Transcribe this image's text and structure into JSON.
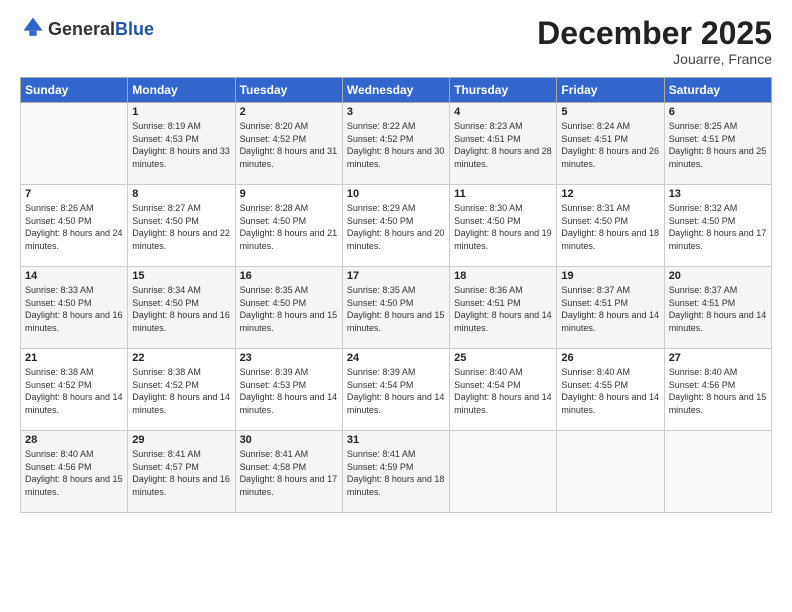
{
  "logo": {
    "general": "General",
    "blue": "Blue"
  },
  "header": {
    "month": "December 2025",
    "location": "Jouarre, France"
  },
  "weekdays": [
    "Sunday",
    "Monday",
    "Tuesday",
    "Wednesday",
    "Thursday",
    "Friday",
    "Saturday"
  ],
  "weeks": [
    [
      {
        "day": "",
        "sunrise": "",
        "sunset": "",
        "daylight": ""
      },
      {
        "day": "1",
        "sunrise": "Sunrise: 8:19 AM",
        "sunset": "Sunset: 4:53 PM",
        "daylight": "Daylight: 8 hours and 33 minutes."
      },
      {
        "day": "2",
        "sunrise": "Sunrise: 8:20 AM",
        "sunset": "Sunset: 4:52 PM",
        "daylight": "Daylight: 8 hours and 31 minutes."
      },
      {
        "day": "3",
        "sunrise": "Sunrise: 8:22 AM",
        "sunset": "Sunset: 4:52 PM",
        "daylight": "Daylight: 8 hours and 30 minutes."
      },
      {
        "day": "4",
        "sunrise": "Sunrise: 8:23 AM",
        "sunset": "Sunset: 4:51 PM",
        "daylight": "Daylight: 8 hours and 28 minutes."
      },
      {
        "day": "5",
        "sunrise": "Sunrise: 8:24 AM",
        "sunset": "Sunset: 4:51 PM",
        "daylight": "Daylight: 8 hours and 26 minutes."
      },
      {
        "day": "6",
        "sunrise": "Sunrise: 8:25 AM",
        "sunset": "Sunset: 4:51 PM",
        "daylight": "Daylight: 8 hours and 25 minutes."
      }
    ],
    [
      {
        "day": "7",
        "sunrise": "Sunrise: 8:26 AM",
        "sunset": "Sunset: 4:50 PM",
        "daylight": "Daylight: 8 hours and 24 minutes."
      },
      {
        "day": "8",
        "sunrise": "Sunrise: 8:27 AM",
        "sunset": "Sunset: 4:50 PM",
        "daylight": "Daylight: 8 hours and 22 minutes."
      },
      {
        "day": "9",
        "sunrise": "Sunrise: 8:28 AM",
        "sunset": "Sunset: 4:50 PM",
        "daylight": "Daylight: 8 hours and 21 minutes."
      },
      {
        "day": "10",
        "sunrise": "Sunrise: 8:29 AM",
        "sunset": "Sunset: 4:50 PM",
        "daylight": "Daylight: 8 hours and 20 minutes."
      },
      {
        "day": "11",
        "sunrise": "Sunrise: 8:30 AM",
        "sunset": "Sunset: 4:50 PM",
        "daylight": "Daylight: 8 hours and 19 minutes."
      },
      {
        "day": "12",
        "sunrise": "Sunrise: 8:31 AM",
        "sunset": "Sunset: 4:50 PM",
        "daylight": "Daylight: 8 hours and 18 minutes."
      },
      {
        "day": "13",
        "sunrise": "Sunrise: 8:32 AM",
        "sunset": "Sunset: 4:50 PM",
        "daylight": "Daylight: 8 hours and 17 minutes."
      }
    ],
    [
      {
        "day": "14",
        "sunrise": "Sunrise: 8:33 AM",
        "sunset": "Sunset: 4:50 PM",
        "daylight": "Daylight: 8 hours and 16 minutes."
      },
      {
        "day": "15",
        "sunrise": "Sunrise: 8:34 AM",
        "sunset": "Sunset: 4:50 PM",
        "daylight": "Daylight: 8 hours and 16 minutes."
      },
      {
        "day": "16",
        "sunrise": "Sunrise: 8:35 AM",
        "sunset": "Sunset: 4:50 PM",
        "daylight": "Daylight: 8 hours and 15 minutes."
      },
      {
        "day": "17",
        "sunrise": "Sunrise: 8:35 AM",
        "sunset": "Sunset: 4:50 PM",
        "daylight": "Daylight: 8 hours and 15 minutes."
      },
      {
        "day": "18",
        "sunrise": "Sunrise: 8:36 AM",
        "sunset": "Sunset: 4:51 PM",
        "daylight": "Daylight: 8 hours and 14 minutes."
      },
      {
        "day": "19",
        "sunrise": "Sunrise: 8:37 AM",
        "sunset": "Sunset: 4:51 PM",
        "daylight": "Daylight: 8 hours and 14 minutes."
      },
      {
        "day": "20",
        "sunrise": "Sunrise: 8:37 AM",
        "sunset": "Sunset: 4:51 PM",
        "daylight": "Daylight: 8 hours and 14 minutes."
      }
    ],
    [
      {
        "day": "21",
        "sunrise": "Sunrise: 8:38 AM",
        "sunset": "Sunset: 4:52 PM",
        "daylight": "Daylight: 8 hours and 14 minutes."
      },
      {
        "day": "22",
        "sunrise": "Sunrise: 8:38 AM",
        "sunset": "Sunset: 4:52 PM",
        "daylight": "Daylight: 8 hours and 14 minutes."
      },
      {
        "day": "23",
        "sunrise": "Sunrise: 8:39 AM",
        "sunset": "Sunset: 4:53 PM",
        "daylight": "Daylight: 8 hours and 14 minutes."
      },
      {
        "day": "24",
        "sunrise": "Sunrise: 8:39 AM",
        "sunset": "Sunset: 4:54 PM",
        "daylight": "Daylight: 8 hours and 14 minutes."
      },
      {
        "day": "25",
        "sunrise": "Sunrise: 8:40 AM",
        "sunset": "Sunset: 4:54 PM",
        "daylight": "Daylight: 8 hours and 14 minutes."
      },
      {
        "day": "26",
        "sunrise": "Sunrise: 8:40 AM",
        "sunset": "Sunset: 4:55 PM",
        "daylight": "Daylight: 8 hours and 14 minutes."
      },
      {
        "day": "27",
        "sunrise": "Sunrise: 8:40 AM",
        "sunset": "Sunset: 4:56 PM",
        "daylight": "Daylight: 8 hours and 15 minutes."
      }
    ],
    [
      {
        "day": "28",
        "sunrise": "Sunrise: 8:40 AM",
        "sunset": "Sunset: 4:56 PM",
        "daylight": "Daylight: 8 hours and 15 minutes."
      },
      {
        "day": "29",
        "sunrise": "Sunrise: 8:41 AM",
        "sunset": "Sunset: 4:57 PM",
        "daylight": "Daylight: 8 hours and 16 minutes."
      },
      {
        "day": "30",
        "sunrise": "Sunrise: 8:41 AM",
        "sunset": "Sunset: 4:58 PM",
        "daylight": "Daylight: 8 hours and 17 minutes."
      },
      {
        "day": "31",
        "sunrise": "Sunrise: 8:41 AM",
        "sunset": "Sunset: 4:59 PM",
        "daylight": "Daylight: 8 hours and 18 minutes."
      },
      {
        "day": "",
        "sunrise": "",
        "sunset": "",
        "daylight": ""
      },
      {
        "day": "",
        "sunrise": "",
        "sunset": "",
        "daylight": ""
      },
      {
        "day": "",
        "sunrise": "",
        "sunset": "",
        "daylight": ""
      }
    ]
  ]
}
